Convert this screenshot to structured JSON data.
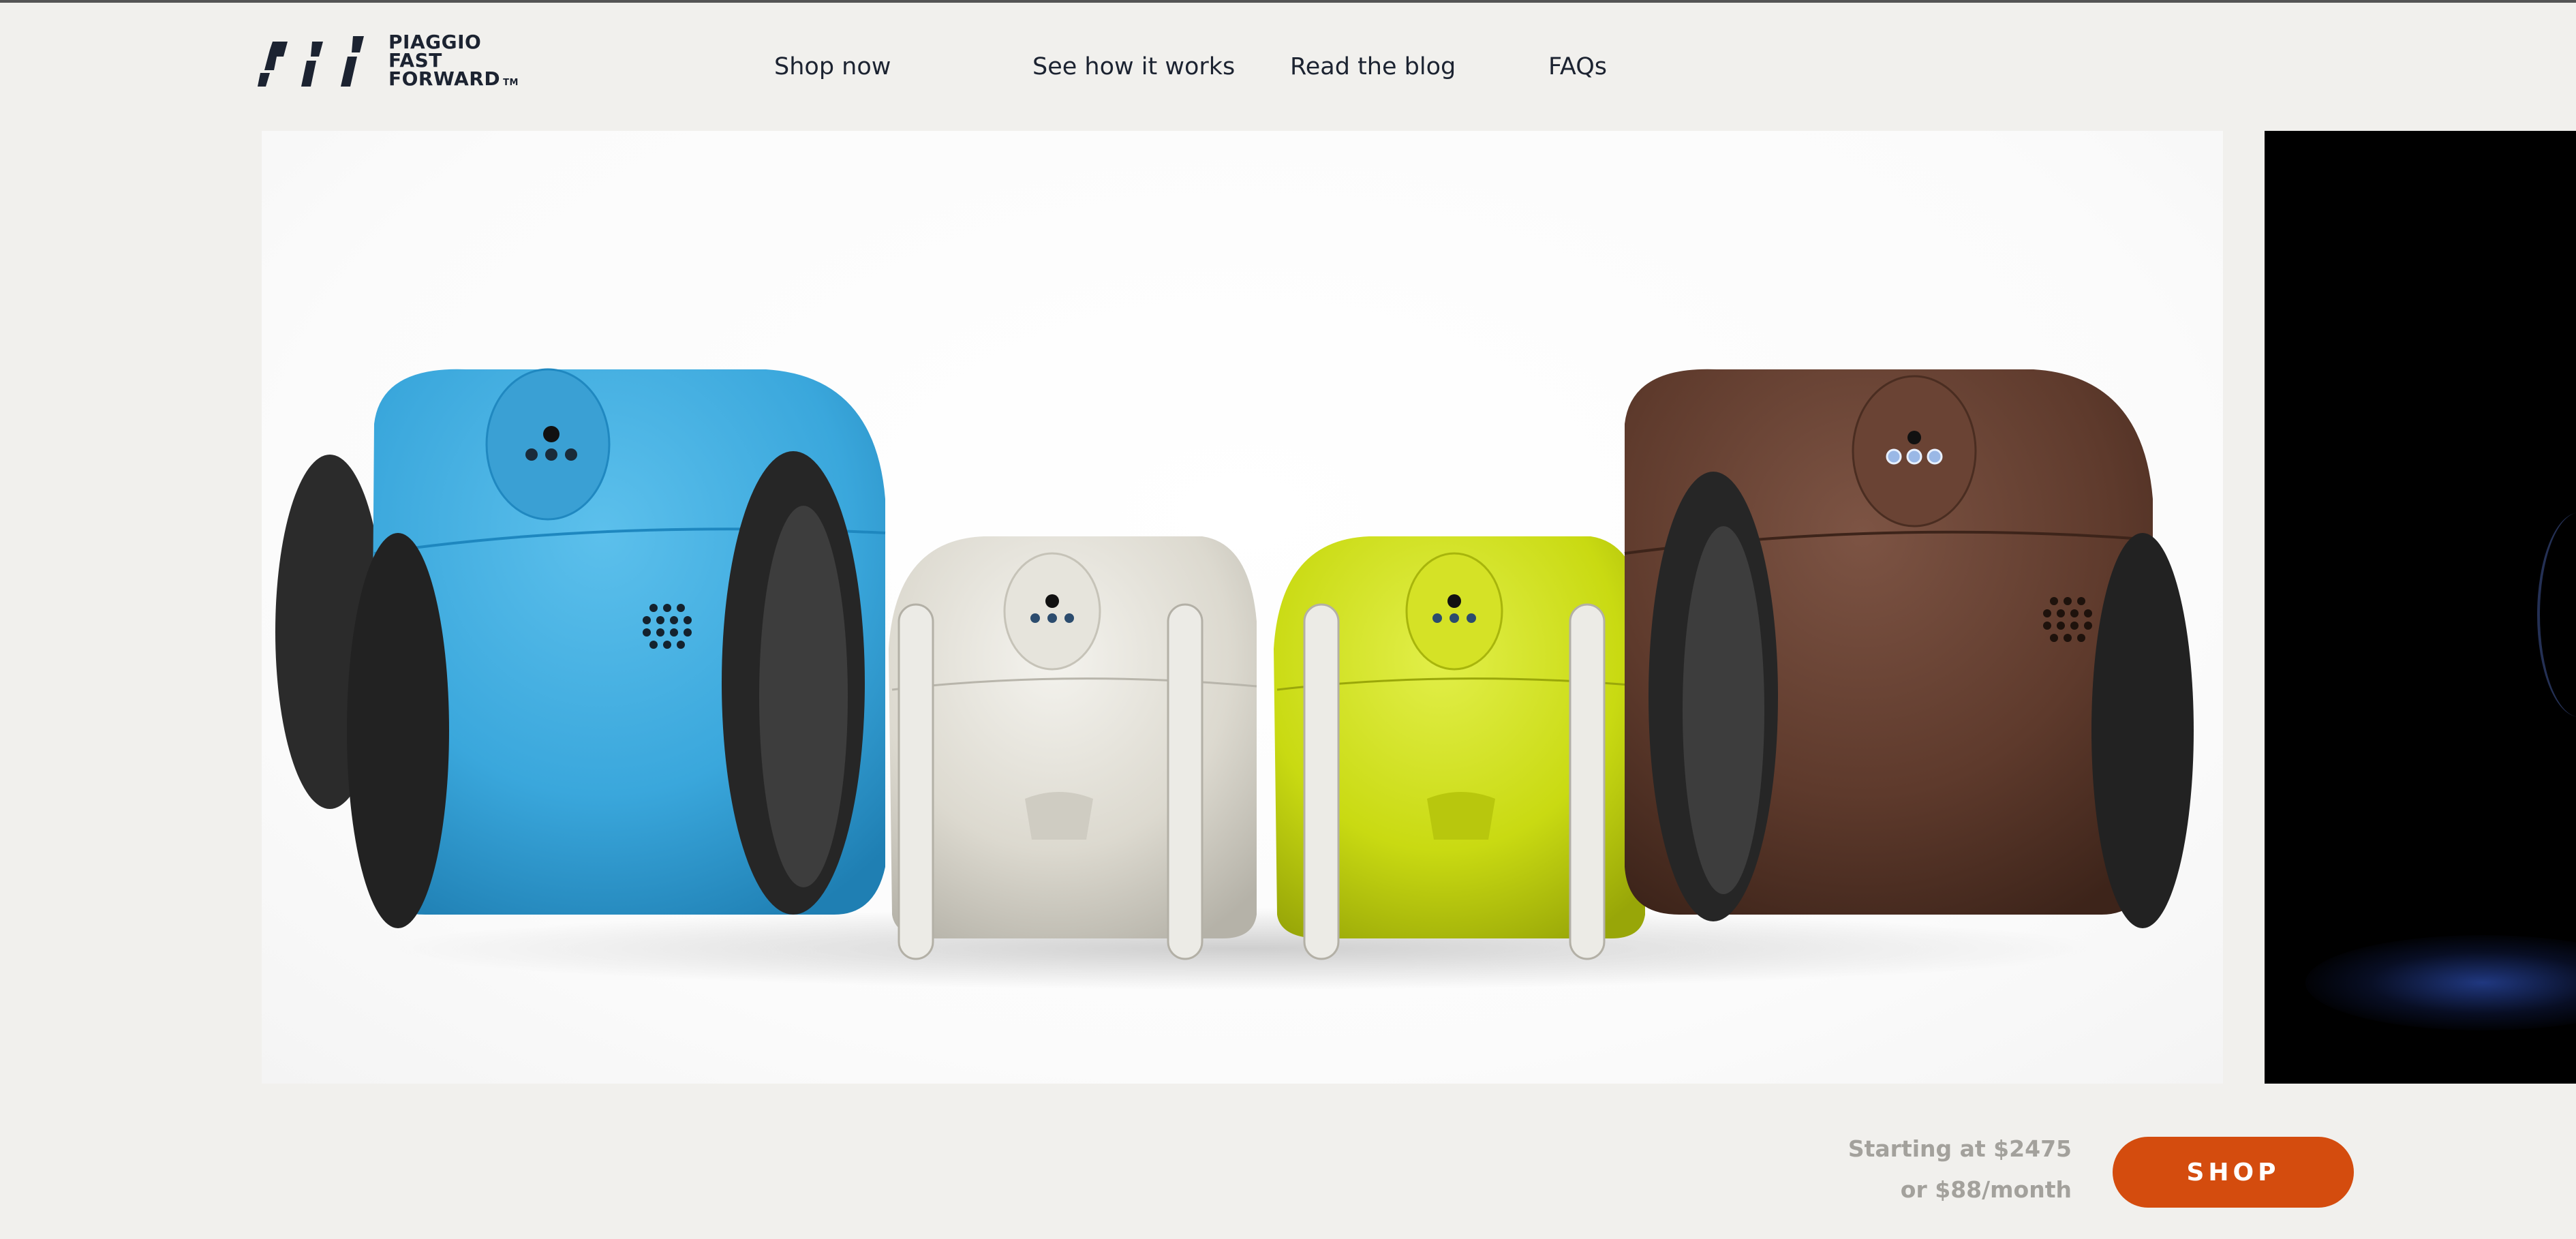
{
  "header": {
    "logo": {
      "line1": "PIAGGIO",
      "line2": "FAST",
      "line3": "FORWARD",
      "tm": "TM",
      "icon": "pff-logo-icon"
    },
    "nav": [
      {
        "label": "Shop now"
      },
      {
        "label": "See how it works"
      },
      {
        "label": "Read the blog"
      },
      {
        "label": "FAQs"
      }
    ]
  },
  "hero": {
    "image": "gita-robots-lineup",
    "robots": [
      {
        "name": "blue-robot",
        "color": "#3aa7dc"
      },
      {
        "name": "white-robot",
        "color": "#dcd9cf"
      },
      {
        "name": "lime-robot",
        "color": "#c9da12"
      },
      {
        "name": "brown-robot",
        "color": "#5e3a2c"
      }
    ]
  },
  "cta": {
    "price_line1": "Starting at $2475",
    "price_line2": "or $88/month",
    "button_label": "SHOP",
    "button_color": "#d44c0e"
  }
}
